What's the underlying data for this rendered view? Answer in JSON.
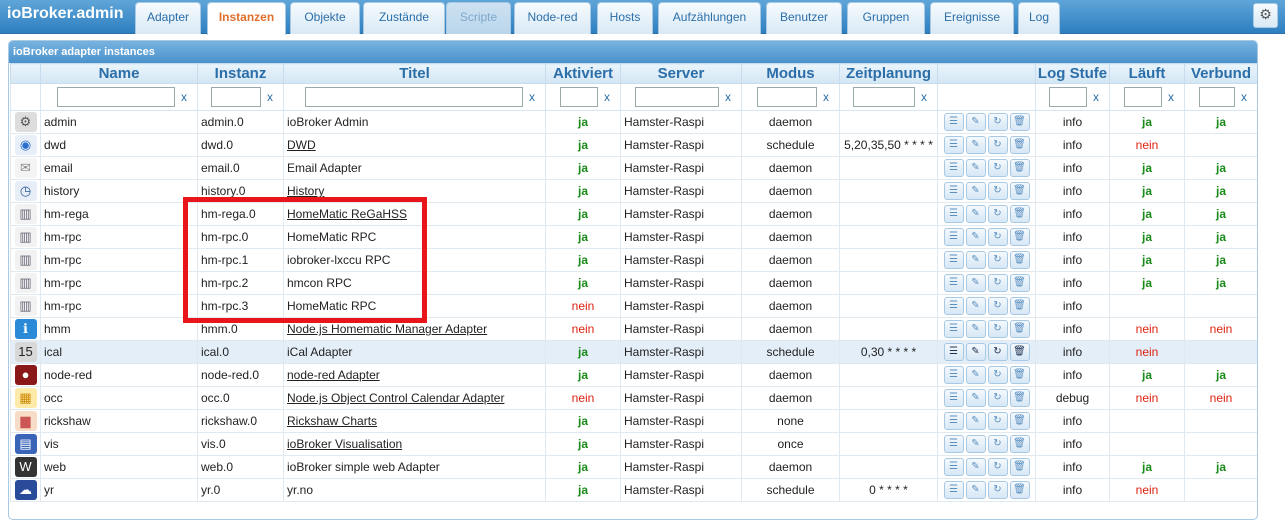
{
  "app": {
    "title": "ioBroker.admin"
  },
  "tabs": [
    {
      "label": "Adapter",
      "state": "normal"
    },
    {
      "label": "Instanzen",
      "state": "active"
    },
    {
      "label": "Objekte",
      "state": "normal"
    },
    {
      "label": "Zustände",
      "state": "normal"
    },
    {
      "label": "Scripte",
      "state": "disabled"
    },
    {
      "label": "Node-red",
      "state": "normal"
    },
    {
      "label": "Hosts",
      "state": "normal"
    },
    {
      "label": "Aufzählungen",
      "state": "normal"
    },
    {
      "label": "Benutzer",
      "state": "normal"
    },
    {
      "label": "Gruppen",
      "state": "normal"
    },
    {
      "label": "Ereignisse",
      "state": "normal"
    },
    {
      "label": "Log",
      "state": "normal"
    }
  ],
  "panel": {
    "title": "ioBroker adapter instances"
  },
  "columns": [
    "Name",
    "Instanz",
    "Titel",
    "Aktiviert",
    "Server",
    "Modus",
    "Zeitplanung",
    "",
    "Log Stufe",
    "Läuft",
    "Verbund"
  ],
  "filter_clear": "x",
  "rows": [
    {
      "icon": "admin-gear-icon",
      "name": "admin",
      "instance": "admin.0",
      "title": "ioBroker Admin",
      "link": false,
      "enabled": "ja",
      "server": "Hamster-Raspi",
      "mode": "daemon",
      "schedule": "",
      "log": "info",
      "alive": "ja",
      "connected": "ja"
    },
    {
      "icon": "dwd-icon",
      "name": "dwd",
      "instance": "dwd.0",
      "title": "DWD",
      "link": true,
      "enabled": "ja",
      "server": "Hamster-Raspi",
      "mode": "schedule",
      "schedule": "5,20,35,50 * * * *",
      "log": "info",
      "alive": "nein",
      "connected": ""
    },
    {
      "icon": "email-icon",
      "name": "email",
      "instance": "email.0",
      "title": "Email Adapter",
      "link": false,
      "enabled": "ja",
      "server": "Hamster-Raspi",
      "mode": "daemon",
      "schedule": "",
      "log": "info",
      "alive": "ja",
      "connected": "ja"
    },
    {
      "icon": "history-clock-icon",
      "name": "history",
      "instance": "history.0",
      "title": "History",
      "link": true,
      "enabled": "ja",
      "server": "Hamster-Raspi",
      "mode": "daemon",
      "schedule": "",
      "log": "info",
      "alive": "ja",
      "connected": "ja"
    },
    {
      "icon": "homematic-icon",
      "name": "hm-rega",
      "instance": "hm-rega.0",
      "title": "HomeMatic ReGaHSS",
      "link": true,
      "enabled": "ja",
      "server": "Hamster-Raspi",
      "mode": "daemon",
      "schedule": "",
      "log": "info",
      "alive": "ja",
      "connected": "ja"
    },
    {
      "icon": "homematic-icon",
      "name": "hm-rpc",
      "instance": "hm-rpc.0",
      "title": "HomeMatic RPC",
      "link": false,
      "enabled": "ja",
      "server": "Hamster-Raspi",
      "mode": "daemon",
      "schedule": "",
      "log": "info",
      "alive": "ja",
      "connected": "ja"
    },
    {
      "icon": "homematic-icon",
      "name": "hm-rpc",
      "instance": "hm-rpc.1",
      "title": "iobroker-lxccu RPC",
      "link": false,
      "enabled": "ja",
      "server": "Hamster-Raspi",
      "mode": "daemon",
      "schedule": "",
      "log": "info",
      "alive": "ja",
      "connected": "ja"
    },
    {
      "icon": "homematic-icon",
      "name": "hm-rpc",
      "instance": "hm-rpc.2",
      "title": "hmcon RPC",
      "link": false,
      "enabled": "ja",
      "server": "Hamster-Raspi",
      "mode": "daemon",
      "schedule": "",
      "log": "info",
      "alive": "ja",
      "connected": "ja"
    },
    {
      "icon": "homematic-icon",
      "name": "hm-rpc",
      "instance": "hm-rpc.3",
      "title": "HomeMatic RPC",
      "link": false,
      "enabled": "nein",
      "server": "Hamster-Raspi",
      "mode": "daemon",
      "schedule": "",
      "log": "info",
      "alive": "",
      "connected": ""
    },
    {
      "icon": "hmm-info-icon",
      "name": "hmm",
      "instance": "hmm.0",
      "title": "Node.js Homematic Manager Adapter",
      "link": true,
      "enabled": "nein",
      "server": "Hamster-Raspi",
      "mode": "daemon",
      "schedule": "",
      "log": "info",
      "alive": "nein",
      "connected": "nein"
    },
    {
      "icon": "ical-calendar-icon",
      "name": "ical",
      "instance": "ical.0",
      "title": "iCal Adapter",
      "link": false,
      "enabled": "ja",
      "server": "Hamster-Raspi",
      "mode": "schedule",
      "schedule": "0,30 * * * *",
      "log": "info",
      "alive": "nein",
      "connected": "",
      "selected": true
    },
    {
      "icon": "node-red-icon",
      "name": "node-red",
      "instance": "node-red.0",
      "title": "node-red Adapter",
      "link": true,
      "enabled": "ja",
      "server": "Hamster-Raspi",
      "mode": "daemon",
      "schedule": "",
      "log": "info",
      "alive": "ja",
      "connected": "ja"
    },
    {
      "icon": "occ-calendar-icon",
      "name": "occ",
      "instance": "occ.0",
      "title": "Node.js Object Control Calendar Adapter",
      "link": true,
      "enabled": "nein",
      "server": "Hamster-Raspi",
      "mode": "daemon",
      "schedule": "",
      "log": "debug",
      "alive": "nein",
      "connected": "nein"
    },
    {
      "icon": "rickshaw-chart-icon",
      "name": "rickshaw",
      "instance": "rickshaw.0",
      "title": "Rickshaw Charts",
      "link": true,
      "enabled": "ja",
      "server": "Hamster-Raspi",
      "mode": "none",
      "schedule": "",
      "log": "info",
      "alive": "",
      "connected": ""
    },
    {
      "icon": "vis-icon",
      "name": "vis",
      "instance": "vis.0",
      "title": "ioBroker Visualisation",
      "link": true,
      "enabled": "ja",
      "server": "Hamster-Raspi",
      "mode": "once",
      "schedule": "",
      "log": "info",
      "alive": "",
      "connected": ""
    },
    {
      "icon": "web-www-icon",
      "name": "web",
      "instance": "web.0",
      "title": "ioBroker simple web Adapter",
      "link": false,
      "enabled": "ja",
      "server": "Hamster-Raspi",
      "mode": "daemon",
      "schedule": "",
      "log": "info",
      "alive": "ja",
      "connected": "ja"
    },
    {
      "icon": "yr-weather-icon",
      "name": "yr",
      "instance": "yr.0",
      "title": "yr.no",
      "link": false,
      "enabled": "ja",
      "server": "Hamster-Raspi",
      "mode": "schedule",
      "schedule": "0 * * * *",
      "log": "info",
      "alive": "nein",
      "connected": ""
    }
  ],
  "row_buttons": [
    {
      "name": "settings-list-icon",
      "glyph": "☰"
    },
    {
      "name": "edit-pencil-icon",
      "glyph": "✎"
    },
    {
      "name": "restart-reload-icon",
      "glyph": "↻"
    },
    {
      "name": "delete-trash-icon",
      "glyph": "🗑"
    }
  ],
  "colors": {
    "yes": "#1a8a1a",
    "no": "#dd2211",
    "highlight": "#e8151a",
    "tab_active": "#e0702f"
  }
}
